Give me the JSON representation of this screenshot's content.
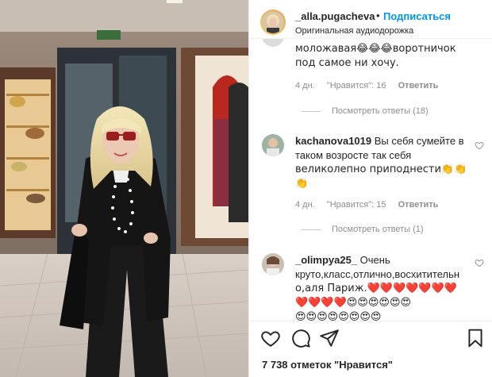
{
  "header": {
    "username": "_alla.pugacheva",
    "separator": "•",
    "follow_label": "Подписаться",
    "audio_label": "Оригинальная аудиодорожка"
  },
  "comments": [
    {
      "line1": "моложавая😂😂😂воротничок",
      "line2": "под самое ни хочу.",
      "time": "4 дн.",
      "likes": "\"Нравится\": 16",
      "reply": "Ответить",
      "view_replies": "Посмотреть ответы (18)"
    },
    {
      "user": "kachanova1019",
      "line1_rest": " Вы себя сумейте в",
      "line2": "таком возросте так себя",
      "line3": "великолепно приподнести👏👏",
      "line4": "👏",
      "time": "4 дн.",
      "likes": "\"Нравится\": 15",
      "reply": "Ответить",
      "view_replies": "Посмотреть ответы (1)"
    },
    {
      "user": "_olimpya25_",
      "line1_rest": " Очень",
      "line2": "круто,класс,отлично,восхитительн",
      "line3": "о,аля Париж.❤️❤️❤️❤️❤️❤️❤️",
      "line4": "❤️❤️❤️❤️😍😍😍😍😍😍",
      "line5": "😍😍😍😍😍😍😍😍"
    }
  ],
  "footer": {
    "likes_text": "7 738 отметок \"Нравится\""
  },
  "icons": {
    "like": "heart-icon",
    "comment": "comment-icon",
    "share": "share-icon",
    "save": "bookmark-icon"
  },
  "colors": {
    "accent": "#0095f6",
    "text": "#262626",
    "muted": "#8e8e8e"
  }
}
